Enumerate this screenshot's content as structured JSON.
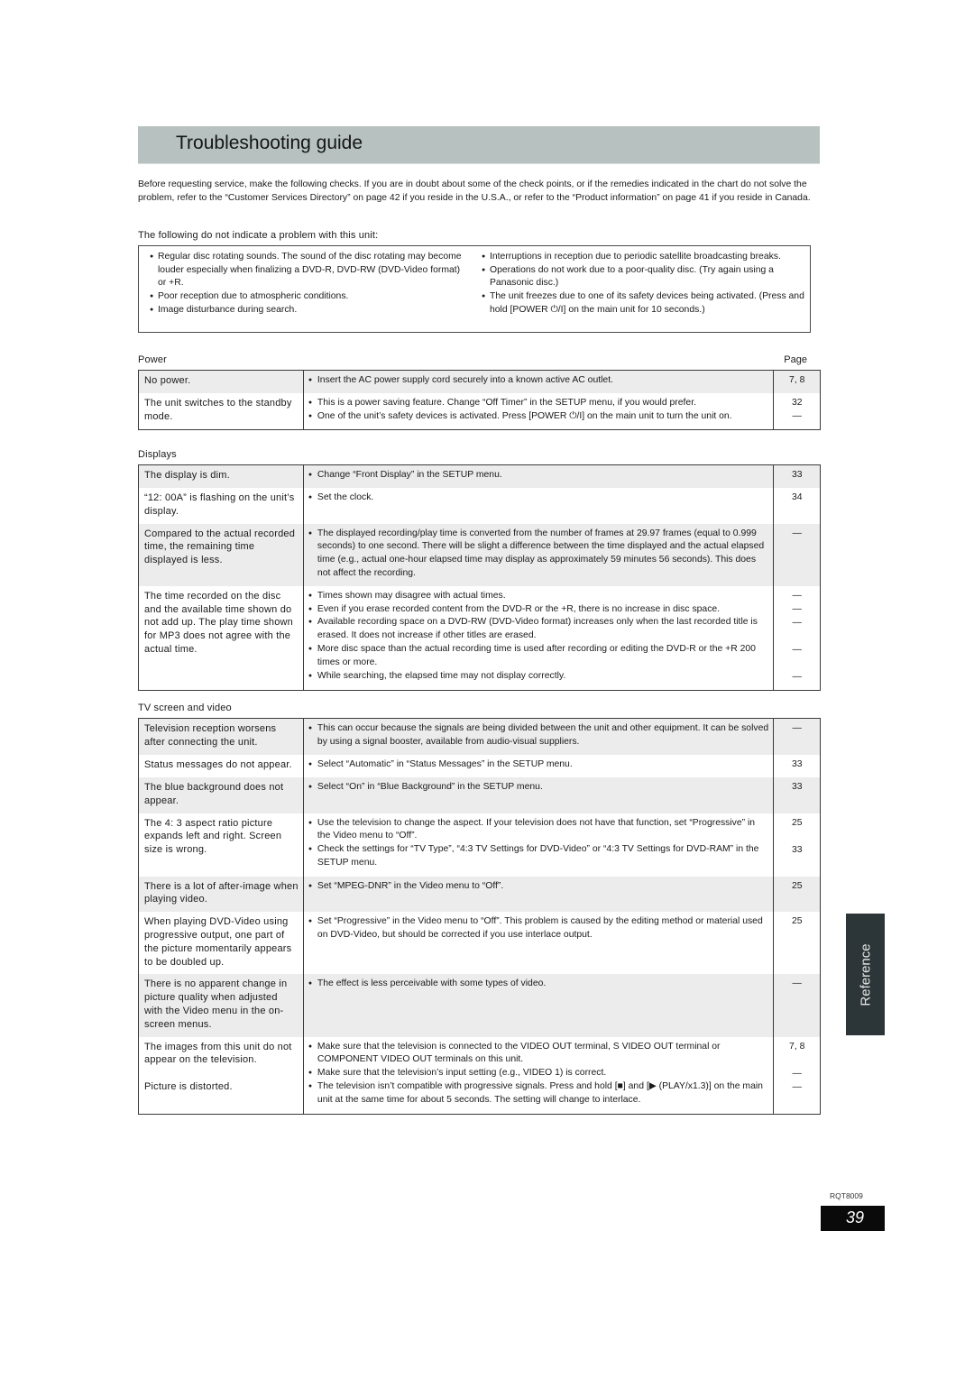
{
  "header": {
    "title": "Troubleshooting guide"
  },
  "intro": "Before requesting service, make the following checks. If you are in doubt about some of the check points, or if the remedies indicated in the chart do not solve the problem, refer to the “Customer Services Directory” on page 42 if you reside in the U.S.A., or refer to the “Product information” on page 41 if you reside in Canada.",
  "notes": {
    "label": "The following do not indicate a problem with this unit:",
    "left": [
      "Regular disc rotating sounds. The sound of the disc rotating may become louder especially when finalizing a DVD-R, DVD-RW (DVD-Video format) or +R.",
      "Poor reception due to atmospheric conditions.",
      "Image disturbance during search."
    ],
    "right": [
      "Interruptions in reception due to periodic satellite broadcasting breaks.",
      "Operations do not work due to a poor-quality disc. (Try again using a Panasonic disc.)",
      "The unit freezes due to one of its safety devices being activated. (Press and hold [POWER ⏻/I] on the main unit for 10 seconds.)"
    ]
  },
  "page_column_label": "Page",
  "sections": [
    {
      "title": "Power",
      "rows": [
        {
          "problem": "No power.",
          "remedies": [
            {
              "text": "Insert the AC power supply cord securely into a known active AC outlet.",
              "page": "7, 8"
            }
          ]
        },
        {
          "problem": "The unit switches to the standby mode.",
          "remedies": [
            {
              "text": "This is a power saving feature. Change “Off Timer” in the SETUP menu, if you would prefer.",
              "page": "32"
            },
            {
              "text": "One of the unit’s safety devices is activated. Press [POWER ⏻/I] on the main unit to turn the unit on.",
              "page": "—"
            }
          ]
        }
      ]
    },
    {
      "title": "Displays",
      "rows": [
        {
          "problem": "The display is dim.",
          "remedies": [
            {
              "text": "Change “Front Display” in the SETUP menu.",
              "page": "33"
            }
          ]
        },
        {
          "problem": "“12: 00A” is flashing on the unit’s display.",
          "remedies": [
            {
              "text": "Set the clock.",
              "page": "34"
            }
          ]
        },
        {
          "problem": "Compared to the actual recorded time, the remaining time displayed is less.",
          "remedies": [
            {
              "text": "The displayed recording/play time is converted from the number of frames at 29.97 frames (equal to 0.999 seconds) to one second. There will be slight a difference between the time displayed and the actual elapsed time (e.g., actual one-hour elapsed time may display as approximately 59 minutes 56 seconds). This does not affect the recording.",
              "page": "—"
            }
          ]
        },
        {
          "problem": "The time recorded on the disc and the available time shown do not add up. The play time shown for MP3 does not agree with the actual time.",
          "remedies": [
            {
              "text": "Times shown may disagree with actual times.",
              "page": "—"
            },
            {
              "text": "Even if you erase recorded content from the DVD-R or the +R, there is no increase in disc space.",
              "page": "—"
            },
            {
              "text": "Available recording space on a DVD-RW (DVD-Video format) increases only when the last recorded title is erased. It does not increase if other titles are erased.",
              "page": "—"
            },
            {
              "text": "More disc space than the actual recording time is used after recording or editing the DVD-R or the +R 200 times or more.",
              "page": "—"
            },
            {
              "text": "While searching, the elapsed time may not display correctly.",
              "page": "—"
            }
          ]
        }
      ]
    },
    {
      "title": "TV screen and video",
      "rows": [
        {
          "problem": "Television reception worsens after connecting the unit.",
          "remedies": [
            {
              "text": "This can occur because the signals are being divided between the unit and other equipment. It can be solved by using a signal booster, available from audio-visual suppliers.",
              "page": "—"
            }
          ]
        },
        {
          "problem": "Status messages do not appear.",
          "remedies": [
            {
              "text": "Select “Automatic” in “Status Messages” in the SETUP menu.",
              "page": "33"
            }
          ]
        },
        {
          "problem": "The blue background does not appear.",
          "remedies": [
            {
              "text": "Select “On” in “Blue Background” in the SETUP menu.",
              "page": "33"
            }
          ]
        },
        {
          "problem": "The 4: 3 aspect ratio picture expands left and right. Screen size is wrong.",
          "remedies": [
            {
              "text": "Use the television to change the aspect. If your television does not have that function, set “Progressive” in the Video menu to “Off”.",
              "page": "25"
            },
            {
              "text": "Check the settings for “TV Type”, “4:3 TV Settings for DVD-Video” or “4:3 TV Settings for DVD-RAM” in the SETUP menu.",
              "page": "33"
            }
          ]
        },
        {
          "problem": "There is a lot of after-image when playing video.",
          "remedies": [
            {
              "text": "Set “MPEG-DNR” in the Video menu to “Off”.",
              "page": "25"
            }
          ]
        },
        {
          "problem": "When playing DVD-Video using progressive output, one part of the picture momentarily appears to be doubled up.",
          "remedies": [
            {
              "text": "Set “Progressive” in the Video menu to “Off”. This problem is caused by the editing method or material used on DVD-Video, but should be corrected if you use interlace output.",
              "page": "25"
            }
          ]
        },
        {
          "problem": "There is no apparent change in picture quality when adjusted with the Video menu in the on-screen menus.",
          "remedies": [
            {
              "text": "The effect is less perceivable with some types of video.",
              "page": "—"
            }
          ]
        },
        {
          "problem": "The images from this unit do not appear on the television.\n\nPicture is distorted.",
          "remedies": [
            {
              "text": "Make sure that the television is connected to the VIDEO OUT terminal, S VIDEO OUT terminal or COMPONENT VIDEO OUT terminals on this unit.",
              "page": "7, 8"
            },
            {
              "text": "Make sure that the television’s input setting (e.g., VIDEO 1) is correct.",
              "page": "—"
            },
            {
              "text": "The television isn’t compatible with progressive signals. Press and hold [■] and [▶ (PLAY/x1.3)] on the main unit at the same time for about 5 seconds. The setting will change to interlace.",
              "page": "—"
            }
          ]
        }
      ]
    }
  ],
  "side_tab": "Reference",
  "footer": {
    "model": "RQT8009",
    "page_number": "39"
  }
}
